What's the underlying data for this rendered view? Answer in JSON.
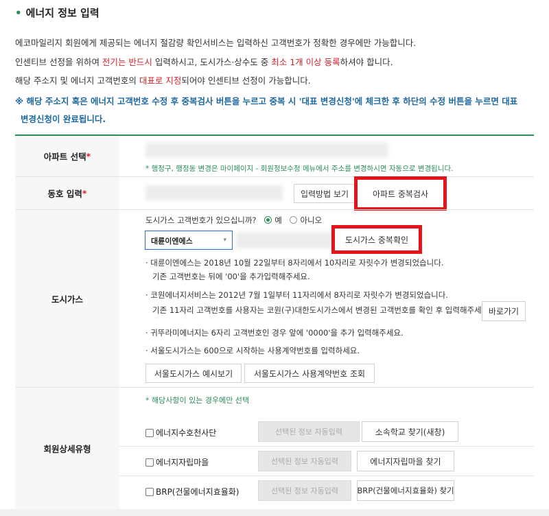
{
  "section_title": "에너지 정보 입력",
  "intro": {
    "line1": "에코마일리지 회원에게 제공되는 에너지 절감량 확인서비스는 입력하신 고객번호가 정확한 경우에만 가능합니다.",
    "line2_a": "인센티브 선정을 위하여 ",
    "line2_red1": "전기는 반드시",
    "line2_b": " 입력하시고, 도시가스·상수도 중 ",
    "line2_red2": "최소 1개 이상 등록",
    "line2_c": "하셔야 합니다.",
    "line3_a": "해당 주소지 및 에너지 고객번호의 ",
    "line3_red": "대표로 지정",
    "line3_b": "되어야 인센티브 선정이 가능합니다."
  },
  "notice": {
    "line1": "※ 해당 주소지 혹은 에너지 고객번호 수정 후 중복검사 버튼을 누르고 중복 시 '대표 변경신청'에 체크한 후 하단의 수정 버튼을 누르면 대표",
    "line2": "변경신청이 완료됩니다."
  },
  "form": {
    "apartment": {
      "label": "아파트 선택",
      "required_mark": "*",
      "hint": "* 행정구, 행정동 변경은 마이페이지 - 회원정보수정 메뉴에서 주소를 변경하시면 자동으로 변경됩니다."
    },
    "unit": {
      "label": "동호 입력",
      "required_mark": "*",
      "input_method_button": "입력방법 보기",
      "dup_check_button": "아파트 중복검사"
    },
    "gas": {
      "label": "도시가스",
      "question": "도시가스 고객번호가 있으십니까?",
      "yes": "예",
      "no": "아니오",
      "selected_company": "대륜이엔에스",
      "dup_confirm_button": "도시가스 중복확인",
      "notes": [
        "· 대륜이엔에스는 2018년 10월 22일부터 8자리에서 10자리로 자릿수가 변경되었습니다.",
        "  기존 고객번호는 뒤에 '00'을 추가입력해주세요.",
        "· 코원에너지서비스는 2012년 7월 1일부터 11자리에서 8자리로 자릿수가 변경되었습니다.",
        "  기존 11자리 고객번호를 사용자는 코원(구)대한도시가스에서 변경된 고객번호를 확인 후 입력해주세요.",
        "· 귀뚜라미에너지는 6자리 고객번호인 경우 앞에 '0000'을 추가 입력해주세요.",
        "· 서울도시가스는 600으로 시작하는 사용계약번호를 입력하세요."
      ],
      "goto_button": "바로가기",
      "seoul_example_button": "서울도시가스 예시보기",
      "seoul_lookup_button": "서울도시가스 사용계약번호 조회"
    },
    "member_type": {
      "label": "회원상세유형",
      "hint": "* 해당사항이 있는 경우에만 선택",
      "rows": [
        {
          "checkbox_label": "에너지수호천사단",
          "auto_field": "선택된 정보 자동입력",
          "button": "소속학교 찾기(새창)"
        },
        {
          "checkbox_label": "에너지자립마을",
          "auto_field": "선택된 정보 자동입력",
          "button": "에너지자립마을 찾기"
        },
        {
          "checkbox_label": "BRP(건물에너지효율화)",
          "auto_field": "선택된 정보 자동입력",
          "button": "BRP(건물에너지효율화) 찾기"
        }
      ]
    }
  },
  "colors": {
    "accent_green": "#2a8c5a",
    "notice_blue": "#1e6aa0",
    "required_red": "#d6212a",
    "highlight_box_red": "#e5141b"
  }
}
